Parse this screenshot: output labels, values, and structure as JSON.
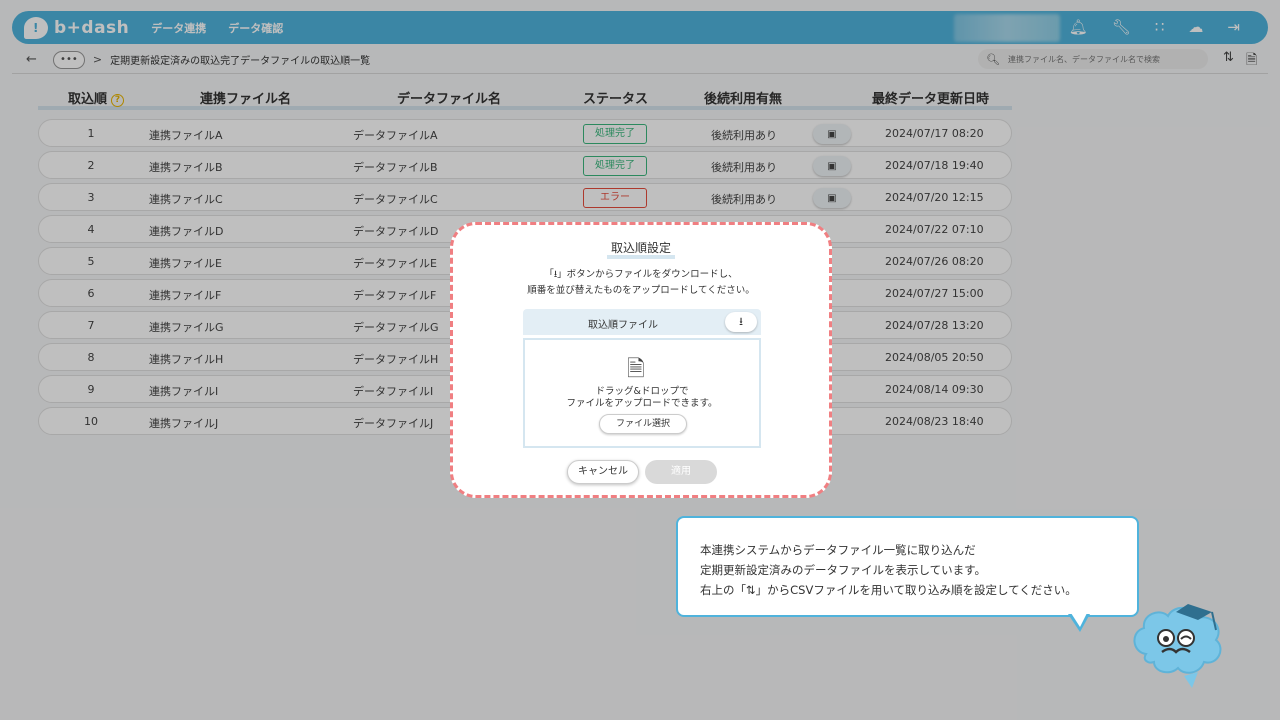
{
  "header": {
    "logo_text": "b+dash",
    "nav": [
      "データ連携",
      "データ確認"
    ],
    "icons": [
      "bell-icon",
      "wrench-icon",
      "grid-icon",
      "brain-icon",
      "logout-icon"
    ]
  },
  "breadcrumb": {
    "more_label": "•••",
    "separator": ">",
    "current": "定期更新設定済みの取込完了データファイルの取込順一覧"
  },
  "search": {
    "placeholder": "連携ファイル名、データファイル名で検索"
  },
  "table": {
    "headers": {
      "order": "取込順",
      "link_file": "連携ファイル名",
      "data_file": "データファイル名",
      "status": "ステータス",
      "followup": "後続利用有無",
      "last_updated": "最終データ更新日時"
    },
    "rows": [
      {
        "order": "1",
        "link": "連携ファイルA",
        "data": "データファイルA",
        "status": "処理完了",
        "use": "後続利用あり",
        "date": "2024/07/17 08:20"
      },
      {
        "order": "2",
        "link": "連携ファイルB",
        "data": "データファイルB",
        "status": "処理完了",
        "use": "後続利用あり",
        "date": "2024/07/18 19:40"
      },
      {
        "order": "3",
        "link": "連携ファイルC",
        "data": "データファイルC",
        "status": "エラー",
        "use": "後続利用あり",
        "date": "2024/07/20 12:15"
      },
      {
        "order": "4",
        "link": "連携ファイルD",
        "data": "データファイルD",
        "status": "",
        "use": "",
        "date": "2024/07/22 07:10"
      },
      {
        "order": "5",
        "link": "連携ファイルE",
        "data": "データファイルE",
        "status": "",
        "use": "",
        "date": "2024/07/26 08:20"
      },
      {
        "order": "6",
        "link": "連携ファイルF",
        "data": "データファイルF",
        "status": "",
        "use": "",
        "date": "2024/07/27 15:00"
      },
      {
        "order": "7",
        "link": "連携ファイルG",
        "data": "データファイルG",
        "status": "",
        "use": "",
        "date": "2024/07/28 13:20"
      },
      {
        "order": "8",
        "link": "連携ファイルH",
        "data": "データファイルH",
        "status": "",
        "use": "",
        "date": "2024/08/05 20:50"
      },
      {
        "order": "9",
        "link": "連携ファイルI",
        "data": "データファイルI",
        "status": "",
        "use": "",
        "date": "2024/08/14 09:30"
      },
      {
        "order": "10",
        "link": "連携ファイルJ",
        "data": "データファイルJ",
        "status": "",
        "use": "",
        "date": "2024/08/23 18:40"
      }
    ]
  },
  "modal": {
    "title": "取込順設定",
    "desc_pre": "「",
    "desc_post": "」ボタンからファイルをダウンロードし、",
    "desc_line2": "順番を並び替えたものをアップロードしてください。",
    "file_label": "取込順ファイル",
    "drop_line1": "ドラッグ&ドロップで",
    "drop_line2": "ファイルをアップロードできます。",
    "select_button": "ファイル選択",
    "cancel_button": "キャンセル",
    "apply_button": "適用"
  },
  "guide": {
    "line1": "本連携システムからデータファイル一覧に取り込んだ",
    "line2": "定期更新設定済みのデータファイルを表示しています。",
    "line3_pre": "右上の「",
    "line3_post": "」からCSVファイルを用いて取り込み順を設定してください。"
  },
  "colors": {
    "brand": "#4fb3dc",
    "success": "#3bb77e",
    "error": "#e74c3c",
    "modal_border": "#f07f82"
  }
}
